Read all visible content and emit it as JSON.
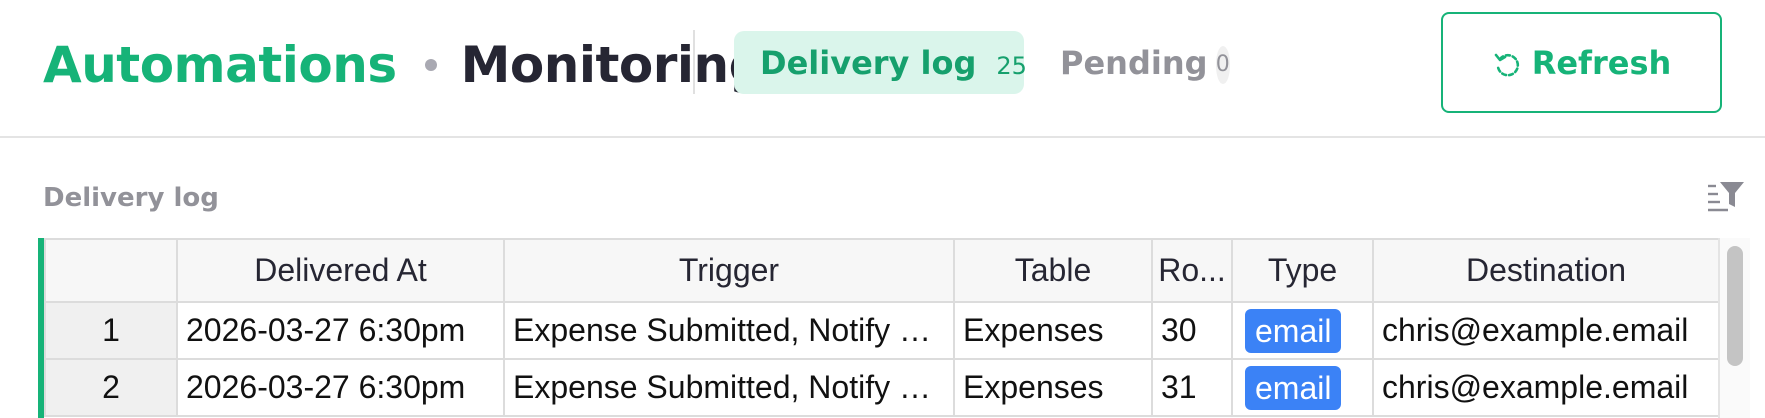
{
  "header": {
    "breadcrumb_parent": "Automations",
    "breadcrumb_current": "Monitoring",
    "tabs": [
      {
        "label": "Delivery log",
        "count": "25",
        "active": true
      },
      {
        "label": "Pending",
        "count": "0",
        "active": false
      }
    ],
    "refresh_label": "Refresh"
  },
  "section": {
    "title": "Delivery log",
    "filter_icon": "filter-icon"
  },
  "table": {
    "columns": [
      "Delivered At",
      "Trigger",
      "Table",
      "Ro...",
      "Type",
      "Destination"
    ],
    "rows": [
      {
        "num": "1",
        "delivered_at": "2026-03-27 6:30pm",
        "trigger": "Expense Submitted, Notify …",
        "table": "Expenses",
        "row": "30",
        "type": "email",
        "destination": "chris@example.email"
      },
      {
        "num": "2",
        "delivered_at": "2026-03-27 6:30pm",
        "trigger": "Expense Submitted, Notify …",
        "table": "Expenses",
        "row": "31",
        "type": "email",
        "destination": "chris@example.email"
      }
    ]
  },
  "colors": {
    "accent": "#16b378",
    "tab_active_bg": "#daf5eb",
    "pill": "#3b82f6"
  }
}
